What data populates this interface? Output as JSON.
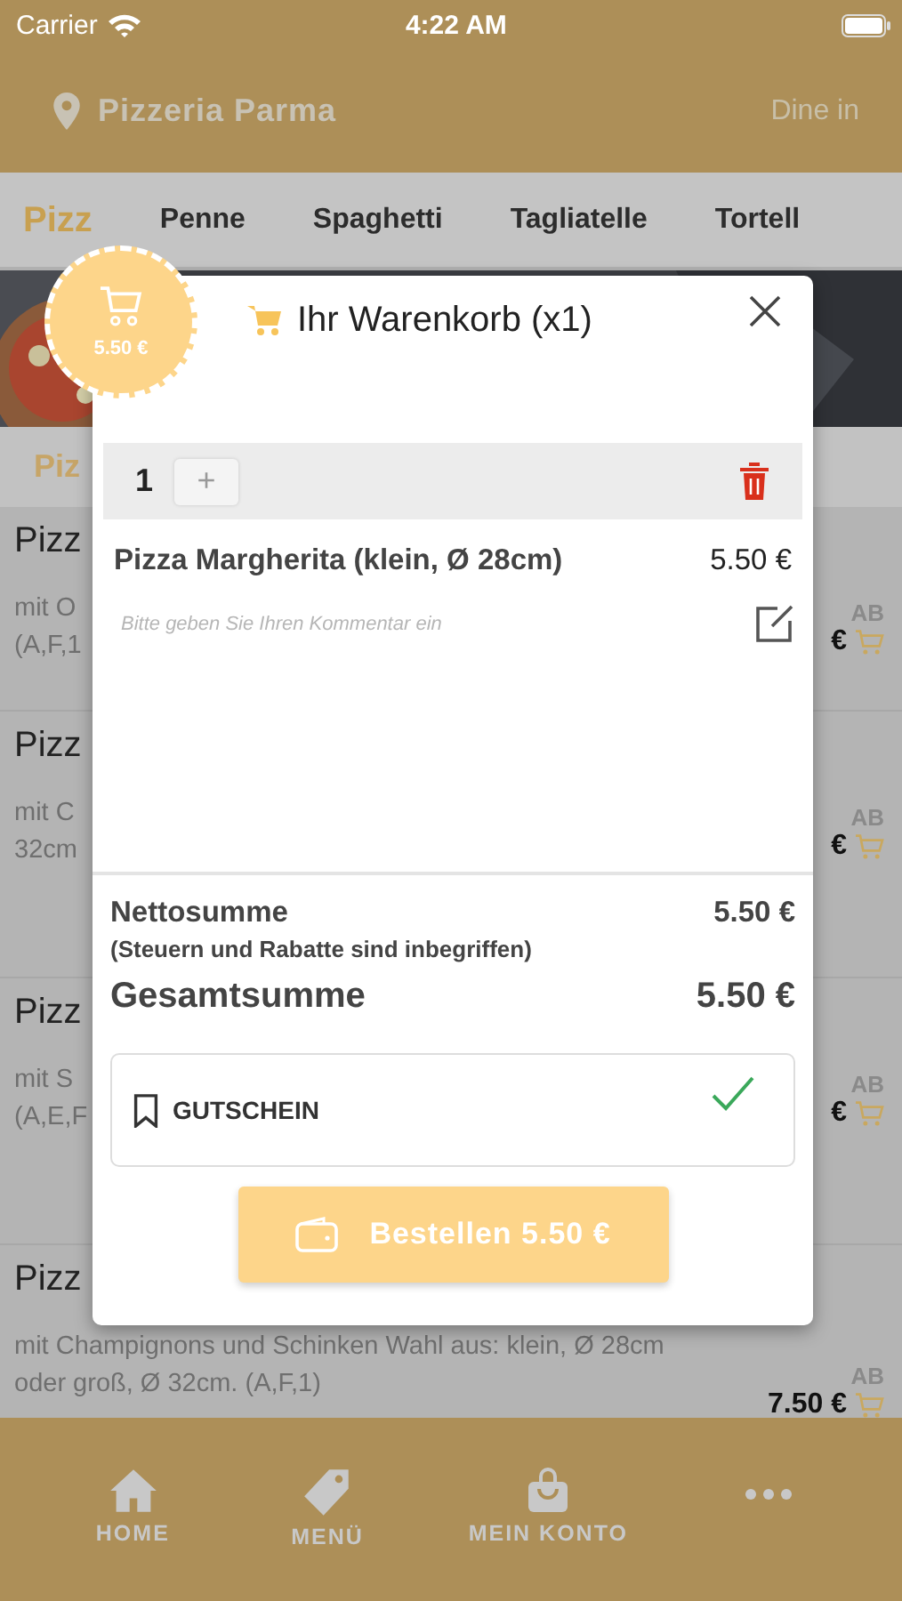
{
  "status_bar": {
    "carrier": "Carrier",
    "time": "4:22 AM"
  },
  "header": {
    "restaurant": "Pizzeria Parma",
    "mode": "Dine in"
  },
  "categories": [
    {
      "label": "Pizz",
      "selected": true
    },
    {
      "label": "Penne",
      "selected": false
    },
    {
      "label": "Spaghetti",
      "selected": false
    },
    {
      "label": "Tagliatelle",
      "selected": false
    },
    {
      "label": "Tortell",
      "selected": false
    }
  ],
  "section_title": "Piz",
  "products": [
    {
      "title": "Pizz",
      "description": [
        "mit O",
        "(A,F,1"
      ],
      "price_prefix": "AB",
      "price": "€"
    },
    {
      "title": "Pizz",
      "description": [
        "mit C",
        "32cm"
      ],
      "price_prefix": "AB",
      "price": "€"
    },
    {
      "title": "Pizz",
      "description": [
        "mit S",
        "(A,E,F"
      ],
      "price_prefix": "AB",
      "price": "€"
    },
    {
      "title": "Pizz",
      "description": [
        "mit Champignons und Schinken Wahl aus: klein, Ø 28cm",
        "oder groß, Ø 32cm. (A,F,1)"
      ],
      "price_prefix": "AB",
      "price": "7.50 €"
    }
  ],
  "cart_badge": {
    "total": "5.50 €"
  },
  "cart": {
    "title": "Ihr Warenkorb (x1)",
    "items": [
      {
        "quantity": "1",
        "add": "+",
        "name": "Pizza Margherita (klein, Ø 28cm)",
        "price": "5.50 €",
        "comment_placeholder": "Bitte geben Sie Ihren Kommentar ein"
      }
    ],
    "net_label": "Nettosumme",
    "net_note": "(Steuern und Rabatte sind inbegriffen)",
    "net_value": "5.50 €",
    "total_label": "Gesamtsumme",
    "total_value": "5.50 €",
    "voucher": {
      "label": "GUTSCHEIN",
      "applied": true
    },
    "order_button": "Bestellen 5.50 €"
  },
  "bottom_nav": [
    {
      "kind": "home",
      "label": "HOME"
    },
    {
      "kind": "tag",
      "label": "MENÜ"
    },
    {
      "kind": "bag",
      "label": "MEIN KONTO"
    },
    {
      "kind": "more"
    }
  ]
}
